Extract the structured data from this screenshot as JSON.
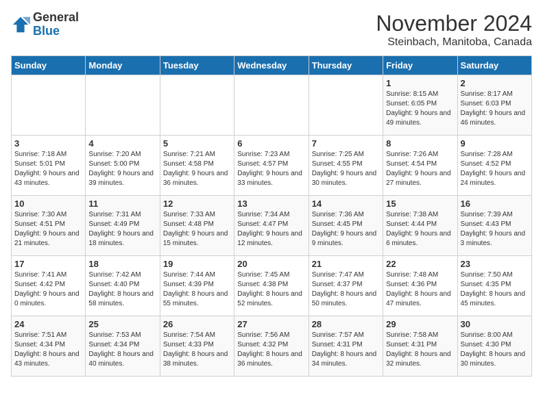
{
  "logo": {
    "general": "General",
    "blue": "Blue"
  },
  "title": "November 2024",
  "subtitle": "Steinbach, Manitoba, Canada",
  "days_of_week": [
    "Sunday",
    "Monday",
    "Tuesday",
    "Wednesday",
    "Thursday",
    "Friday",
    "Saturday"
  ],
  "weeks": [
    [
      {
        "day": "",
        "info": ""
      },
      {
        "day": "",
        "info": ""
      },
      {
        "day": "",
        "info": ""
      },
      {
        "day": "",
        "info": ""
      },
      {
        "day": "",
        "info": ""
      },
      {
        "day": "1",
        "info": "Sunrise: 8:15 AM\nSunset: 6:05 PM\nDaylight: 9 hours and 49 minutes."
      },
      {
        "day": "2",
        "info": "Sunrise: 8:17 AM\nSunset: 6:03 PM\nDaylight: 9 hours and 46 minutes."
      }
    ],
    [
      {
        "day": "3",
        "info": "Sunrise: 7:18 AM\nSunset: 5:01 PM\nDaylight: 9 hours and 43 minutes."
      },
      {
        "day": "4",
        "info": "Sunrise: 7:20 AM\nSunset: 5:00 PM\nDaylight: 9 hours and 39 minutes."
      },
      {
        "day": "5",
        "info": "Sunrise: 7:21 AM\nSunset: 4:58 PM\nDaylight: 9 hours and 36 minutes."
      },
      {
        "day": "6",
        "info": "Sunrise: 7:23 AM\nSunset: 4:57 PM\nDaylight: 9 hours and 33 minutes."
      },
      {
        "day": "7",
        "info": "Sunrise: 7:25 AM\nSunset: 4:55 PM\nDaylight: 9 hours and 30 minutes."
      },
      {
        "day": "8",
        "info": "Sunrise: 7:26 AM\nSunset: 4:54 PM\nDaylight: 9 hours and 27 minutes."
      },
      {
        "day": "9",
        "info": "Sunrise: 7:28 AM\nSunset: 4:52 PM\nDaylight: 9 hours and 24 minutes."
      }
    ],
    [
      {
        "day": "10",
        "info": "Sunrise: 7:30 AM\nSunset: 4:51 PM\nDaylight: 9 hours and 21 minutes."
      },
      {
        "day": "11",
        "info": "Sunrise: 7:31 AM\nSunset: 4:49 PM\nDaylight: 9 hours and 18 minutes."
      },
      {
        "day": "12",
        "info": "Sunrise: 7:33 AM\nSunset: 4:48 PM\nDaylight: 9 hours and 15 minutes."
      },
      {
        "day": "13",
        "info": "Sunrise: 7:34 AM\nSunset: 4:47 PM\nDaylight: 9 hours and 12 minutes."
      },
      {
        "day": "14",
        "info": "Sunrise: 7:36 AM\nSunset: 4:45 PM\nDaylight: 9 hours and 9 minutes."
      },
      {
        "day": "15",
        "info": "Sunrise: 7:38 AM\nSunset: 4:44 PM\nDaylight: 9 hours and 6 minutes."
      },
      {
        "day": "16",
        "info": "Sunrise: 7:39 AM\nSunset: 4:43 PM\nDaylight: 9 hours and 3 minutes."
      }
    ],
    [
      {
        "day": "17",
        "info": "Sunrise: 7:41 AM\nSunset: 4:42 PM\nDaylight: 9 hours and 0 minutes."
      },
      {
        "day": "18",
        "info": "Sunrise: 7:42 AM\nSunset: 4:40 PM\nDaylight: 8 hours and 58 minutes."
      },
      {
        "day": "19",
        "info": "Sunrise: 7:44 AM\nSunset: 4:39 PM\nDaylight: 8 hours and 55 minutes."
      },
      {
        "day": "20",
        "info": "Sunrise: 7:45 AM\nSunset: 4:38 PM\nDaylight: 8 hours and 52 minutes."
      },
      {
        "day": "21",
        "info": "Sunrise: 7:47 AM\nSunset: 4:37 PM\nDaylight: 8 hours and 50 minutes."
      },
      {
        "day": "22",
        "info": "Sunrise: 7:48 AM\nSunset: 4:36 PM\nDaylight: 8 hours and 47 minutes."
      },
      {
        "day": "23",
        "info": "Sunrise: 7:50 AM\nSunset: 4:35 PM\nDaylight: 8 hours and 45 minutes."
      }
    ],
    [
      {
        "day": "24",
        "info": "Sunrise: 7:51 AM\nSunset: 4:34 PM\nDaylight: 8 hours and 43 minutes."
      },
      {
        "day": "25",
        "info": "Sunrise: 7:53 AM\nSunset: 4:34 PM\nDaylight: 8 hours and 40 minutes."
      },
      {
        "day": "26",
        "info": "Sunrise: 7:54 AM\nSunset: 4:33 PM\nDaylight: 8 hours and 38 minutes."
      },
      {
        "day": "27",
        "info": "Sunrise: 7:56 AM\nSunset: 4:32 PM\nDaylight: 8 hours and 36 minutes."
      },
      {
        "day": "28",
        "info": "Sunrise: 7:57 AM\nSunset: 4:31 PM\nDaylight: 8 hours and 34 minutes."
      },
      {
        "day": "29",
        "info": "Sunrise: 7:58 AM\nSunset: 4:31 PM\nDaylight: 8 hours and 32 minutes."
      },
      {
        "day": "30",
        "info": "Sunrise: 8:00 AM\nSunset: 4:30 PM\nDaylight: 8 hours and 30 minutes."
      }
    ]
  ]
}
